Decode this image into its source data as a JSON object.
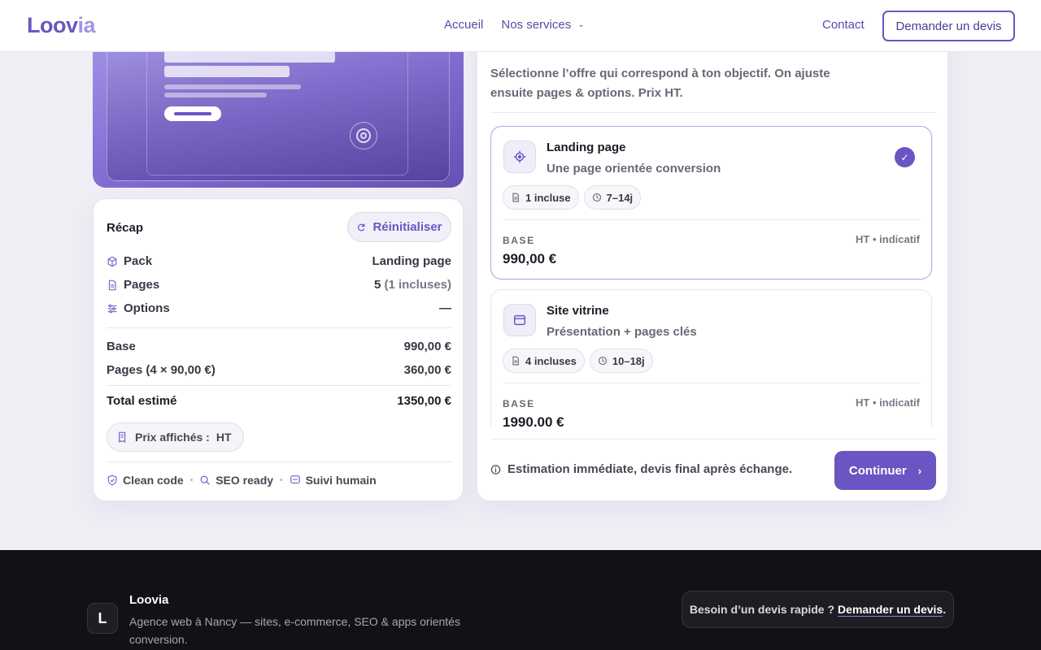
{
  "header": {
    "logo": "Loovia",
    "logo_main": "Loov",
    "logo_accent": "ia",
    "nav": [
      {
        "label": "Accueil"
      },
      {
        "label": "Nos services"
      }
    ],
    "contact_label": "Contact",
    "quote_button": "Demander un devis"
  },
  "recap": {
    "title": "Récap",
    "reset_label": "Réinitialiser",
    "pack_label": "Pack",
    "pack_value": "Landing page",
    "pages_label": "Pages",
    "pages_value": "5",
    "pages_included": "(1 incluses)",
    "options_label": "Options",
    "options_value": "—",
    "base_label": "Base",
    "base_value": "990,00 €",
    "pages_cost_label": "Pages (4 × 90,00 €)",
    "pages_cost_value": "360,00 €",
    "total_label": "Total estimé",
    "total_value": "1350,00 €",
    "price_mode_label": "Prix affichés :",
    "price_mode_value": "HT",
    "badges": [
      "Clean code",
      "SEO ready",
      "Suivi humain"
    ]
  },
  "offers": {
    "intro": "Sélectionne l’offre qui correspond à ton objectif. On ajuste ensuite pages & options. Prix HT.",
    "items": [
      {
        "name": "Landing page",
        "desc": "Une page orientée conversion",
        "pages_chip": "1 incluse",
        "delay_chip": "7–14j",
        "base_label": "BASE",
        "ht_label": "HT • indicatif",
        "price": "990,00 €",
        "selected": true
      },
      {
        "name": "Site vitrine",
        "desc": "Présentation + pages clés",
        "pages_chip": "4 incluses",
        "delay_chip": "10–18j",
        "base_label": "BASE",
        "ht_label": "HT • indicatif",
        "price": "1990,00 €",
        "selected": false
      }
    ],
    "estimate_note": "Estimation immédiate, devis final après échange.",
    "continue_label": "Continuer"
  },
  "footer": {
    "brand": "Loovia",
    "logo_letter": "L",
    "description": "Agence web à Nancy — sites, e-commerce, SEO & apps orientés conversion.",
    "cta_text": "Besoin d’un devis rapide ?",
    "cta_link": "Demander un devis",
    "cta_end": "."
  },
  "colors": {
    "accent": "#6b55c2",
    "footer_bg": "#121216",
    "page_bg": "#efeef5"
  }
}
